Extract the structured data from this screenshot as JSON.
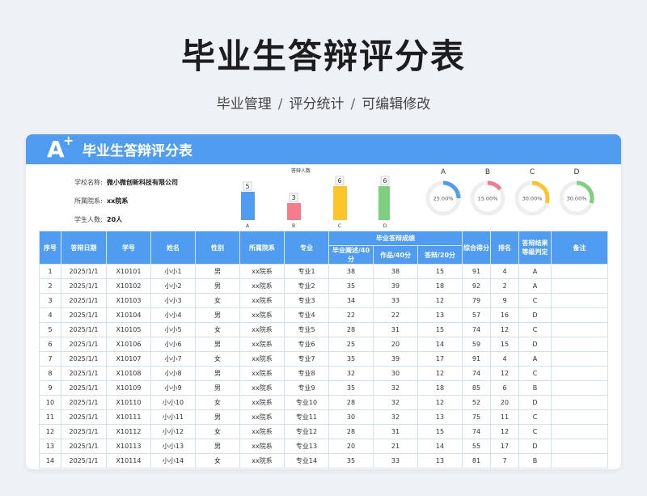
{
  "title": "毕业生答辩评分表",
  "subtitle": [
    "毕业管理",
    "评分统计",
    "可编辑修改"
  ],
  "card": {
    "title": "毕业生答辩评分表",
    "logo_text": "A",
    "school_label": "学校名称:",
    "school_value": "微小微创新科技有限公司",
    "dept_label": "所属院系:",
    "dept_value": "xx院系",
    "count_label": "学生人数:",
    "count_value": "20人"
  },
  "chart_data": {
    "type": "bar",
    "title": "答辩人数",
    "categories": [
      "A",
      "B",
      "C",
      "D"
    ],
    "values": [
      5,
      3,
      6,
      6
    ],
    "colors": [
      "#4f9cf0",
      "#f57c8a",
      "#fcc52a",
      "#7dd07d"
    ]
  },
  "donuts": [
    {
      "label": "A",
      "value": 0.25,
      "text": "25.00%",
      "color": "#4f9cf0"
    },
    {
      "label": "B",
      "value": 0.15,
      "text": "15.00%",
      "color": "#f57c8a"
    },
    {
      "label": "C",
      "value": 0.3,
      "text": "30.00%",
      "color": "#fcc52a"
    },
    {
      "label": "D",
      "value": 0.3,
      "text": "30.00%",
      "color": "#7dd07d"
    }
  ],
  "table": {
    "headers": [
      "序号",
      "答辩日期",
      "学号",
      "姓名",
      "性别",
      "所属院系",
      "专业",
      "毕业答辩成绩",
      "综合得分",
      "排名",
      "答辩结果等级判定",
      "备注"
    ],
    "sub_headers": [
      "毕业阐述/40分",
      "作品/40分",
      "答辩/20分"
    ],
    "rows": [
      [
        "1",
        "2025/1/1",
        "X10101",
        "小小1",
        "男",
        "xx院系",
        "专业1",
        "38",
        "38",
        "15",
        "91",
        "4",
        "A",
        ""
      ],
      [
        "2",
        "2025/1/1",
        "X10102",
        "小小2",
        "男",
        "xx院系",
        "专业2",
        "35",
        "39",
        "18",
        "92",
        "2",
        "A",
        ""
      ],
      [
        "3",
        "2025/1/1",
        "X10103",
        "小小3",
        "女",
        "xx院系",
        "专业3",
        "34",
        "33",
        "12",
        "79",
        "9",
        "C",
        ""
      ],
      [
        "4",
        "2025/1/1",
        "X10104",
        "小小4",
        "男",
        "xx院系",
        "专业4",
        "22",
        "22",
        "13",
        "57",
        "16",
        "D",
        ""
      ],
      [
        "5",
        "2025/1/1",
        "X10105",
        "小小5",
        "女",
        "xx院系",
        "专业5",
        "28",
        "31",
        "15",
        "74",
        "12",
        "C",
        ""
      ],
      [
        "6",
        "2025/1/1",
        "X10106",
        "小小6",
        "男",
        "xx院系",
        "专业6",
        "25",
        "20",
        "14",
        "59",
        "15",
        "D",
        ""
      ],
      [
        "7",
        "2025/1/1",
        "X10107",
        "小小7",
        "女",
        "xx院系",
        "专业7",
        "35",
        "39",
        "17",
        "91",
        "4",
        "A",
        ""
      ],
      [
        "8",
        "2025/1/1",
        "X10108",
        "小小8",
        "男",
        "xx院系",
        "专业8",
        "32",
        "30",
        "12",
        "74",
        "12",
        "C",
        ""
      ],
      [
        "9",
        "2025/1/1",
        "X10109",
        "小小9",
        "男",
        "xx院系",
        "专业9",
        "35",
        "32",
        "18",
        "85",
        "6",
        "B",
        ""
      ],
      [
        "10",
        "2025/1/1",
        "X10110",
        "小小10",
        "女",
        "xx院系",
        "专业10",
        "28",
        "32",
        "12",
        "52",
        "20",
        "D",
        ""
      ],
      [
        "11",
        "2025/1/1",
        "X10111",
        "小小11",
        "男",
        "xx院系",
        "专业11",
        "30",
        "32",
        "13",
        "75",
        "11",
        "C",
        ""
      ],
      [
        "12",
        "2025/1/1",
        "X10112",
        "小小12",
        "女",
        "xx院系",
        "专业12",
        "28",
        "31",
        "15",
        "74",
        "12",
        "C",
        ""
      ],
      [
        "13",
        "2025/1/1",
        "X10113",
        "小小13",
        "男",
        "xx院系",
        "专业13",
        "20",
        "21",
        "14",
        "55",
        "17",
        "D",
        ""
      ],
      [
        "14",
        "2025/1/1",
        "X10114",
        "小小14",
        "女",
        "xx院系",
        "专业14",
        "35",
        "33",
        "13",
        "81",
        "7",
        "B",
        ""
      ]
    ]
  }
}
